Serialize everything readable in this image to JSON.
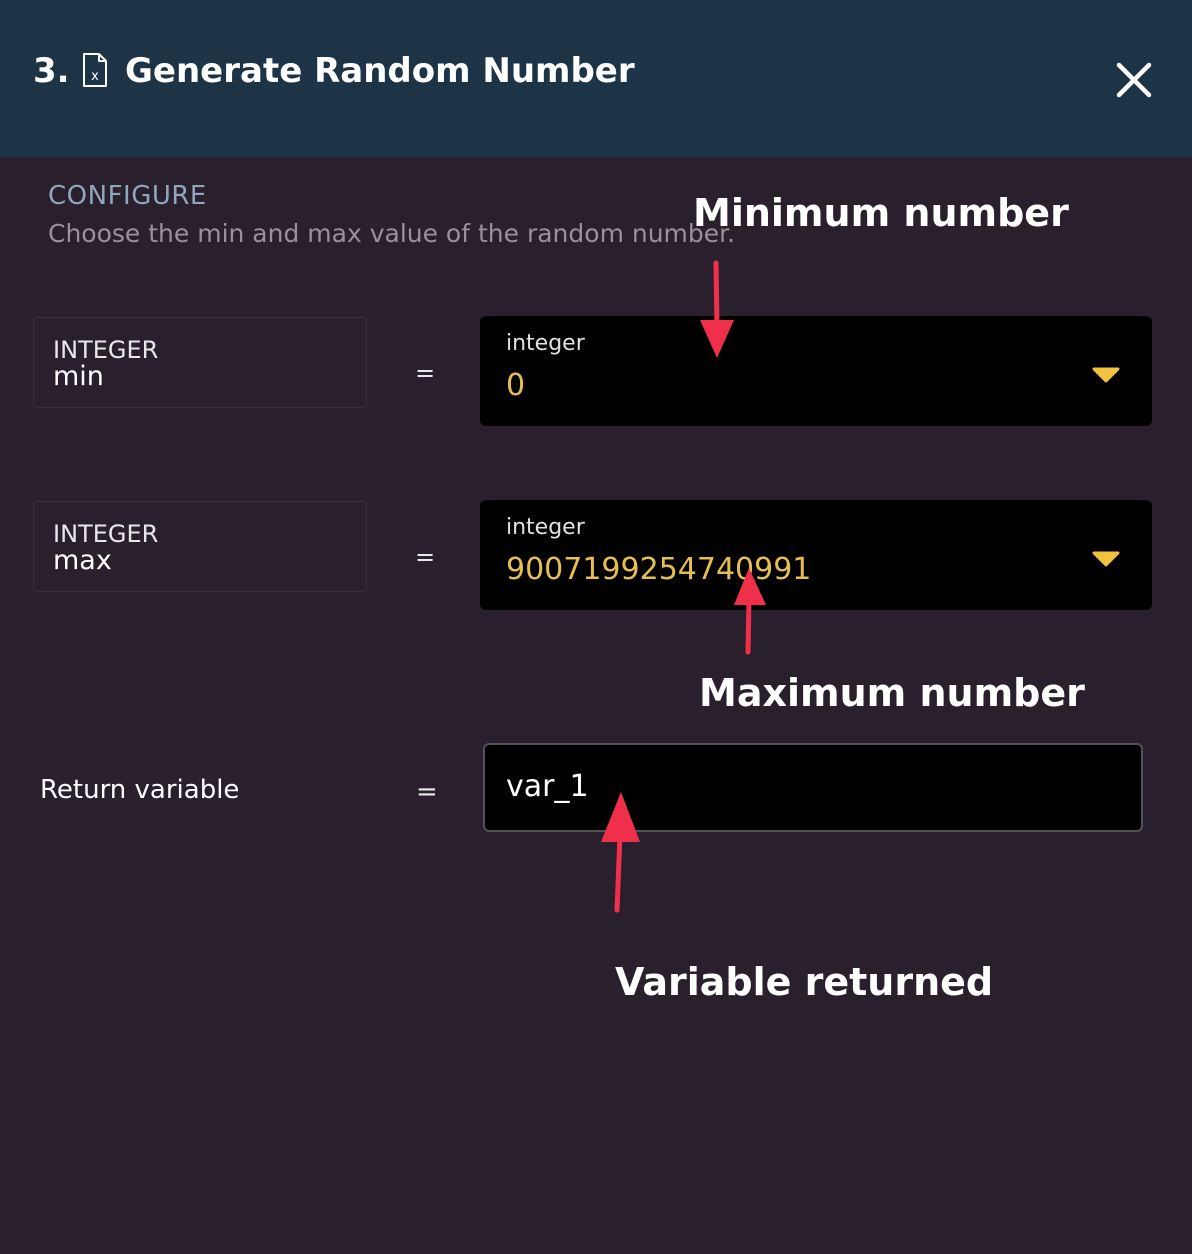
{
  "header": {
    "step_number": "3.",
    "title": "Generate Random Number",
    "icon": "file-variable-icon",
    "close_icon": "close-icon",
    "background_color": "#1d3447"
  },
  "configure": {
    "label": "CONFIGURE",
    "description": "Choose the min and max value of the random number."
  },
  "params": [
    {
      "type": "INTEGER",
      "name": "min",
      "equals": "=",
      "value_kind": "integer",
      "value": "0"
    },
    {
      "type": "INTEGER",
      "name": "max",
      "equals": "=",
      "value_kind": "integer",
      "value": "9007199254740991"
    }
  ],
  "return_variable": {
    "label": "Return variable",
    "equals": "=",
    "value": "var_1"
  },
  "annotations": {
    "minimum": "Minimum number",
    "maximum": "Maximum number",
    "variable": "Variable returned"
  },
  "colors": {
    "background": "#2a1f2d",
    "value_text": "#e6c04f",
    "caret": "#f0c23e",
    "arrow": "#f0304a"
  }
}
